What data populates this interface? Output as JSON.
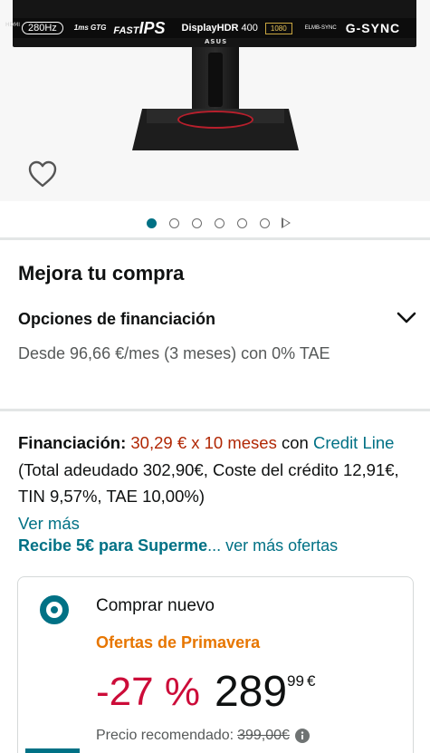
{
  "product_image": {
    "strip_refresh": "280Hz",
    "strip_gtg": "1ms GTG",
    "strip_fast": "FAST",
    "strip_ips": "IPS",
    "strip_hdr": "DisplayHDR",
    "strip_hdr_level": "400",
    "strip_res": "1080",
    "strip_elmb": "ELMB-SYNC",
    "strip_gsync": "G-SYNC",
    "strip_hdmi": "HDMI",
    "brand": "ASUS"
  },
  "gallery": {
    "slide_count": 6,
    "active_slide": 1
  },
  "upgrade": {
    "title": "Mejora tu compra",
    "financing_options_label": "Opciones de financiación",
    "financing_from": "Desde 96,66 €/mes (3 meses) con 0% TAE"
  },
  "financing": {
    "label": "Financiación:",
    "plan": "30,29 € x 10 meses",
    "with": "con",
    "provider_link": "Credit Line",
    "details": "(Total adeudado 302,90€, Coste del crédito 12,91€, TIN 9,57%, TAE 10,00%)",
    "more_link": "Ver más"
  },
  "supermarket": {
    "promo_link": "Recibe 5€ para Superme",
    "more_offers": "... ver más ofertas"
  },
  "buybox": {
    "option_label": "Comprar nuevo",
    "deal_label": "Ofertas de Primavera",
    "discount": "-27 %",
    "price_whole": "289",
    "price_fraction": "99",
    "currency": "€",
    "recommended_label": "Precio recomendado:",
    "recommended_price": "399,00€"
  },
  "colors": {
    "accent": "#007185",
    "deal": "#e77600",
    "discount": "#cc0c39",
    "financing_price": "#b12704"
  }
}
